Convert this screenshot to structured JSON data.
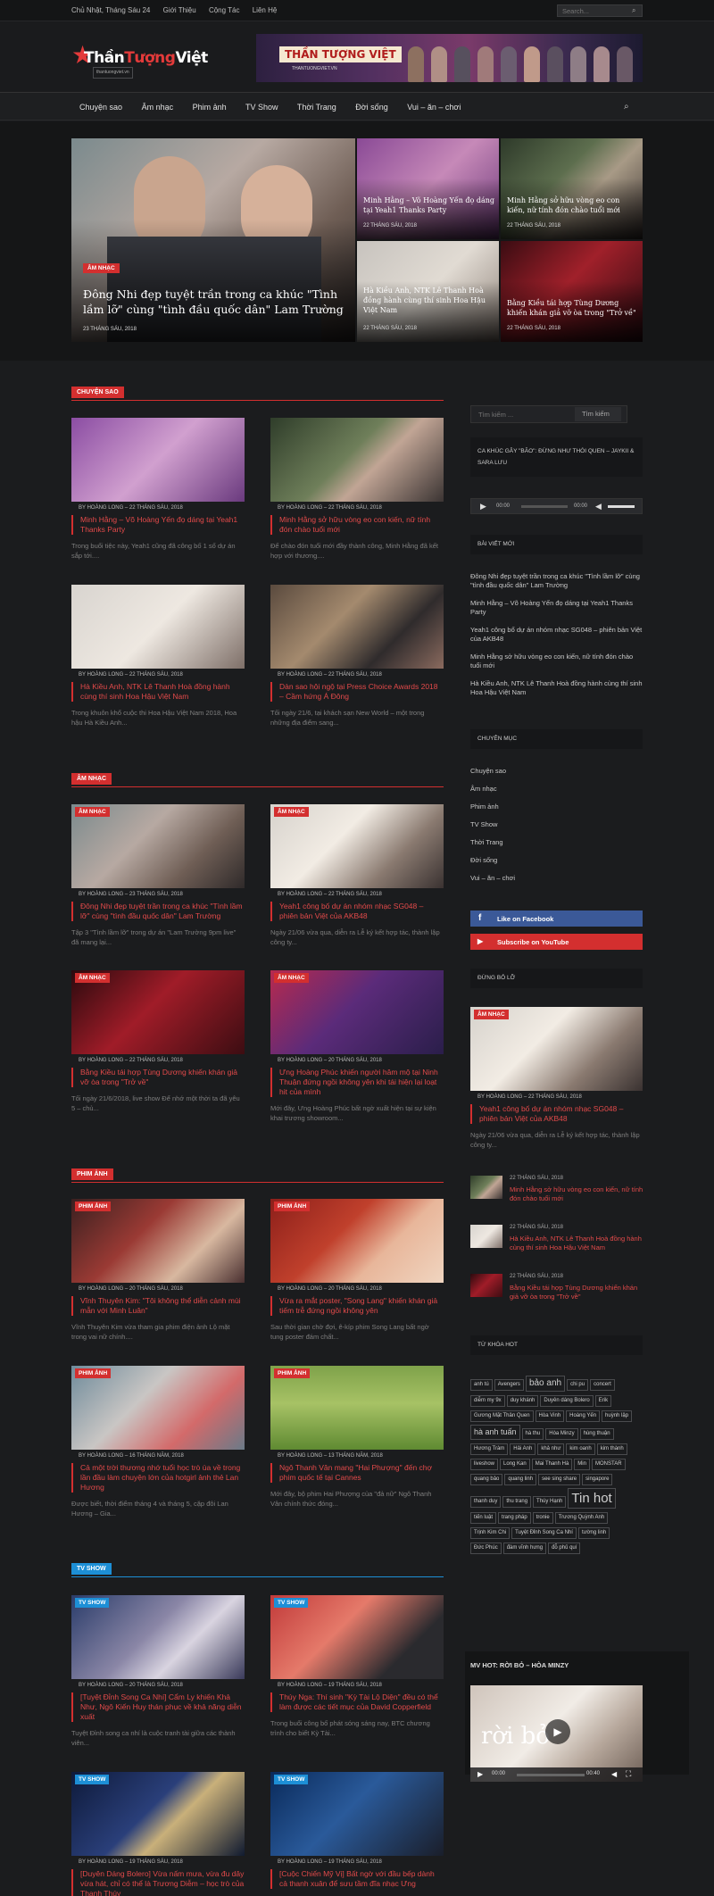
{
  "topbar": {
    "date": "Chủ Nhật, Tháng Sáu 24",
    "links": [
      "Giới Thiệu",
      "Cộng Tác",
      "Liên Hệ"
    ],
    "search_placeholder": "Search..."
  },
  "logo": {
    "name_a": "Thần",
    "name_b": "Tượng",
    "name_c": "Việt",
    "tagline": "thantuongviet.vn"
  },
  "banner": {
    "title": "THẦN TƯỢNG VIỆT",
    "subtitle": "THANTUONGVIET.VN"
  },
  "nav": [
    "Chuyện sao",
    "Âm nhạc",
    "Phim ảnh",
    "TV Show",
    "Thời Trang",
    "Đời sống",
    "Vui – ăn – chơi"
  ],
  "hero": {
    "main": {
      "category": "ÂM NHẠC",
      "title": "Đông Nhi đẹp tuyệt trần trong ca khúc \"Tình lầm lỡ\" cùng \"tình đầu quốc dân\" Lam Trường",
      "date": "23 THÁNG SÁU, 2018"
    },
    "tiles": [
      {
        "title": "Minh Hằng – Võ Hoàng Yến đọ dáng tại Yeah1 Thanks Party",
        "date": "22 THÁNG SÁU, 2018"
      },
      {
        "title": "Minh Hằng sở hữu vòng eo con kiến, nữ tính đón chào tuổi mới",
        "date": "22 THÁNG SÁU, 2018"
      },
      {
        "title": "Hà Kiều Anh, NTK Lê Thanh Hoà đồng hành cùng thí sinh Hoa Hậu Việt Nam",
        "date": "22 THÁNG SÁU, 2018"
      },
      {
        "title": "Bằng Kiều tái hợp Tùng Dương khiến khán giả vỡ òa trong \"Trở về\"",
        "date": "22 THÁNG SÁU, 2018"
      }
    ]
  },
  "sections": [
    {
      "label": "CHUYỆN SAO",
      "cards": [
        {
          "meta": "BY HOÀNG LONG  –  22 THÁNG SÁU, 2018",
          "title": "Minh Hằng – Võ Hoàng Yến đọ dáng tại Yeah1 Thanks Party",
          "excerpt": "Trong buổi tiệc này, Yeah1 cũng đã công bố 1 số dự án sắp tới...."
        },
        {
          "meta": "BY HOÀNG LONG  –  22 THÁNG SÁU, 2018",
          "title": "Minh Hằng sở hữu vòng eo con kiến, nữ tính đón chào tuổi mới",
          "excerpt": "Để chào đón tuổi mới đầy thành công, Minh Hằng đã kết hợp với thương...."
        },
        {
          "meta": "BY HOÀNG LONG  –  22 THÁNG SÁU, 2018",
          "title": "Hà Kiều Anh, NTK Lê Thanh Hoà đồng hành cùng thí sinh Hoa Hậu Việt Nam",
          "excerpt": "Trong khuôn khổ cuộc thi Hoa Hậu Việt Nam 2018, Hoa hậu Hà Kiều Anh..."
        },
        {
          "meta": "BY HOÀNG LONG  –  22 THÁNG SÁU, 2018",
          "title": "Dàn sao hội ngộ tại Press Choice Awards 2018 – Cầm hứng Á Đông",
          "excerpt": "Tối ngày 21/6, tại khách sạn New World – một trong những địa điểm sang..."
        }
      ]
    },
    {
      "label": "ÂM NHẠC",
      "cards": [
        {
          "cat": "ÂM NHẠC",
          "meta": "BY HOÀNG LONG  –  23 THÁNG SÁU, 2018",
          "title": "Đông Nhi đẹp tuyệt trần trong ca khúc \"Tình lầm lỡ\" cùng \"tình đầu quốc dân\" Lam Trường",
          "excerpt": "Tập 3 \"Tình lầm lỡ\" trong dự án \"Lam Trường 9pm live\" đã mang lại..."
        },
        {
          "cat": "ÂM NHẠC",
          "meta": "BY HOÀNG LONG  –  22 THÁNG SÁU, 2018",
          "title": "Yeah1 công bố dự án nhóm nhạc SG048 – phiên bản Việt của AKB48",
          "excerpt": "Ngày 21/06 vừa qua, diễn ra Lễ ký kết hợp tác, thành lập công ty..."
        },
        {
          "cat": "ÂM NHẠC",
          "meta": "BY HOÀNG LONG  –  22 THÁNG SÁU, 2018",
          "title": "Bằng Kiều tái hợp Tùng Dương khiến khán giả vỡ òa trong \"Trở về\"",
          "excerpt": "Tối ngày 21/6/2018, live show Để nhớ một thời ta đã yêu 5 – chủ..."
        },
        {
          "cat": "ÂM NHẠC",
          "meta": "BY HOÀNG LONG  –  20 THÁNG SÁU, 2018",
          "title": "Ưng Hoàng Phúc khiến người hâm mộ tại Ninh Thuận đứng ngồi không yên khi tái hiện lại loạt hit của mình",
          "excerpt": "Mới đây, Ưng Hoàng Phúc bất ngờ xuất hiện tại sự kiện khai trương showroom..."
        }
      ]
    },
    {
      "label": "PHIM ẢNH",
      "cards": [
        {
          "cat": "PHIM ẢNH",
          "meta": "BY HOÀNG LONG  –  20 THÁNG SÁU, 2018",
          "title": "Vĩnh Thuyên Kim: \"Tôi không thể diễn cảnh mùi mẫn với Minh Luân\"",
          "excerpt": "Vĩnh Thuyên Kim vừa tham gia phim điện ảnh Lộ mặt trong vai nữ chính...."
        },
        {
          "cat": "PHIM ẢNH",
          "meta": "BY HOÀNG LONG  –  20 THÁNG SÁU, 2018",
          "title": "Vừa ra mắt poster, \"Song Lang\" khiến khán giả tiếm trễ đứng ngồi không yên",
          "excerpt": "Sau thời gian chờ đợi, ê-kíp phim Song Lang bất ngờ tung poster đám chất..."
        },
        {
          "cat": "PHIM ẢNH",
          "meta": "BY HOÀNG LONG  –  16 THÁNG NĂM, 2018",
          "title": "Cả một trời thương nhớ tuổi học trò ùa về trong lần đầu làm chuyện lớn của hotgirl ảnh thẻ Lan Hương",
          "excerpt": "Được biết, thời điểm tháng 4 và tháng 5, cặp đôi Lan Hương – Gia..."
        },
        {
          "cat": "PHIM ẢNH",
          "meta": "BY HOÀNG LONG  –  13 THÁNG NĂM, 2018",
          "title": "Ngô Thanh Vân mang \"Hai Phượng\" đến chợ phim quốc tế tại Cannes",
          "excerpt": "Mới đây, bộ phim Hai Phượng của \"đả nữ\" Ngô Thanh Vân chính thức đóng..."
        }
      ]
    },
    {
      "label": "TV SHOW",
      "cards": [
        {
          "cat": "TV SHOW",
          "meta": "BY HOÀNG LONG  –  20 THÁNG SÁU, 2018",
          "title": "[Tuyệt Đỉnh Song Ca Nhí] Cẩm Ly khiến Khả Như, Ngô Kiến Huy thán phục về khả năng diễn xuất",
          "excerpt": "Tuyệt Đỉnh song ca nhí là cuộc tranh tài giữa các thành viên..."
        },
        {
          "cat": "TV SHOW",
          "meta": "BY HOÀNG LONG  –  19 THÁNG SÁU, 2018",
          "title": "Thúy Nga: Thí sinh \"Kỳ Tài Lộ Diện\" đều có thể làm được các tiết mục của David Copperfield",
          "excerpt": "Trong buổi công bố phát sóng sáng nay, BTC chương trình cho biết Kỳ Tài..."
        },
        {
          "cat": "TV SHOW",
          "meta": "BY HOÀNG LONG  –  19 THÁNG SÁU, 2018",
          "title": "[Duyên Dáng Bolero] Vừa nấm mưa, vừa đu dây vừa hát, chỉ có thể là Trương Diễm – học trò của Thanh Thúy",
          "excerpt": ""
        },
        {
          "cat": "TV SHOW",
          "meta": "BY HOÀNG LONG  –  19 THÁNG SÁU, 2018",
          "title": "[Cuộc Chiến Mỹ Vị] Bất ngờ với đầu bếp dành cả thanh xuân để sưu tầm đĩa nhạc Ưng",
          "excerpt": ""
        }
      ]
    }
  ],
  "sidebar": {
    "search_placeholder": "Tìm kiếm ...",
    "search_button": "Tìm kiếm",
    "song_head": "CA KHÚC GÂY \"BÃO\": ĐỪNG NHƯ THÓI QUEN – JAYKII & SARA LƯU",
    "player": {
      "t1": "00:00",
      "t2": "00:00"
    },
    "recent_head": "BÀI VIẾT MỚI",
    "recent": [
      "Đông Nhi đẹp tuyệt trần trong ca khúc \"Tình lầm lỡ\" cùng \"tình đầu quốc dân\" Lam Trường",
      "Minh Hằng – Võ Hoàng Yến đọ dáng tại Yeah1 Thanks Party",
      "Yeah1 công bố dự án nhóm nhạc SG048 – phiên bản Việt của AKB48",
      "Minh Hằng sở hữu vòng eo con kiến, nữ tính đón chào tuổi mới",
      "Hà Kiều Anh, NTK Lê Thanh Hoà đồng hành cùng thí sinh Hoa Hậu Việt Nam"
    ],
    "cat_head": "CHUYÊN MỤC",
    "categories": [
      "Chuyện sao",
      "Âm nhạc",
      "Phim ảnh",
      "TV Show",
      "Thời Trang",
      "Đời sống",
      "Vui – ăn – chơi"
    ],
    "facebook": "Like on Facebook",
    "youtube": "Subscribe on YouTube",
    "miss_head": "ĐỪNG BỎ LỠ",
    "miss_main": {
      "cat": "ÂM NHẠC",
      "meta": "BY HOÀNG LONG  –  22 THÁNG SÁU, 2018",
      "title": "Yeah1 công bố dự án nhóm nhạc SG048 – phiên bản Việt của AKB48",
      "excerpt": "Ngày 21/06 vừa qua, diễn ra Lễ ký kết hợp tác, thành lập công ty..."
    },
    "miss_list": [
      {
        "date": "22 THÁNG SÁU, 2018",
        "title": "Minh Hằng sở hữu vòng eo con kiến, nữ tính đón chào tuổi mới"
      },
      {
        "date": "22 THÁNG SÁU, 2018",
        "title": "Hà Kiều Anh, NTK Lê Thanh Hoà đồng hành cùng thí sinh Hoa Hậu Việt Nam"
      },
      {
        "date": "22 THÁNG SÁU, 2018",
        "title": "Bằng Kiều tái hợp Tùng Dương khiến khán giả vỡ òa trong \"Trở về\""
      }
    ],
    "tags_head": "TỪ KHÓA HOT",
    "tags": [
      "anh tú",
      "Avengers",
      "bảo anh",
      "chi pu",
      "concert",
      "diễm my 9x",
      "duy khánh",
      "Duyên dáng Bolero",
      "Erik",
      "Gương Mặt Thân Quen",
      "Hòa Vinh",
      "Hoàng Yến",
      "huỳnh lập",
      "hà anh tuấn",
      "hà thu",
      "Hòa Minzy",
      "hùng thuận",
      "Hương Tràm",
      "Hải Anh",
      "khả như",
      "kim oanh",
      "kim thành",
      "liveshow",
      "Long Kan",
      "Mai Thanh Hà",
      "Min",
      "MONSTAR",
      "quang bảo",
      "quang linh",
      "see sing share",
      "singapore",
      "thanh duy",
      "thu trang",
      "Thúy Hạnh",
      "Tin hot",
      "tiến luật",
      "trang pháp",
      "tronie",
      "Trương Quỳnh Anh",
      "Trịnh Kim Chi",
      "Tuyệt Đỉnh Song Ca Nhí",
      "tường linh",
      "Đức Phúc",
      "đàm vĩnh hưng",
      "đỗ phủ quí"
    ],
    "mv_head": "MV HOT: RỜI BỎ – HÒA MINZY",
    "mv": {
      "overlay": "rời bỏ",
      "t1": "00:00",
      "t2": "00:40"
    }
  },
  "colors": {
    "accent": "#d32f2f",
    "tv": "#1d8fd6",
    "facebook": "#3b5998",
    "youtube": "#d32f2f"
  }
}
